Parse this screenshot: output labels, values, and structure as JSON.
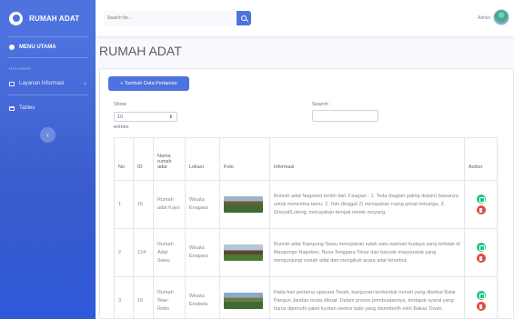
{
  "sidebar": {
    "brand": "RUMAH ADAT",
    "menu_utama": "MENU UTAMA",
    "heading": "HALAMAN",
    "items": [
      {
        "label": "Layanan Informasi",
        "chevron": "›"
      },
      {
        "label": "Tables"
      }
    ],
    "toggle_icon": "‹"
  },
  "topbar": {
    "search_placeholder": "Search for...",
    "user_name": "Admin"
  },
  "page": {
    "title": "RUMAH ADAT",
    "add_button": "+ Tambah Data Pertanian",
    "show_label": "Show",
    "show_value": "10",
    "entries_label": "entries",
    "search_label": "Search:"
  },
  "table": {
    "headers": [
      "No",
      "ID",
      "Nama rumah adat",
      "Lokasi",
      "Foto",
      "Informasi",
      "Action"
    ],
    "rows": [
      {
        "no": "1",
        "id": "15",
        "nama": "Rumah adat Kayo",
        "lokasi": "Wisata Enagara",
        "info": "Rumah adat Nagekeo terdiri dari 3 bagian : 1. Teda (bagian paling depan) biasanya untuk menerima tamu, 2. Tolo (tinggal 2) merupakan ruang privat keluarga, 3. Gheyal/Loteng, merupakan tempat nenek moyang."
      },
      {
        "no": "2",
        "id": "124",
        "nama": "Rumah Adat Sawu",
        "lokasi": "Wisata Enagara",
        "info": "Rumah adat Kampung Sawu merupakan salah satu warisan budaya yang terletak di Maupongo Nagekeo, Nusa Tenggara Timur dan banyak masyarakat yang mengunjungi rumah adat dan mengikuti acara adat tersebut."
      },
      {
        "no": "3",
        "id": "16",
        "nama": "Rumah Wae-Rebo",
        "lokasi": "Wisata Enabela",
        "info": "Pada hari pertama upacara Tiwah, bangunan berbentuk rumah yang disebut Balai Pangun Jandau mulai dibuat. Dalam proses pembuatannya, terdapat syarat yang harus dipenuhi yakni kurban seekor babi yang disembelih oleh Bakas Tiwah."
      }
    ]
  }
}
